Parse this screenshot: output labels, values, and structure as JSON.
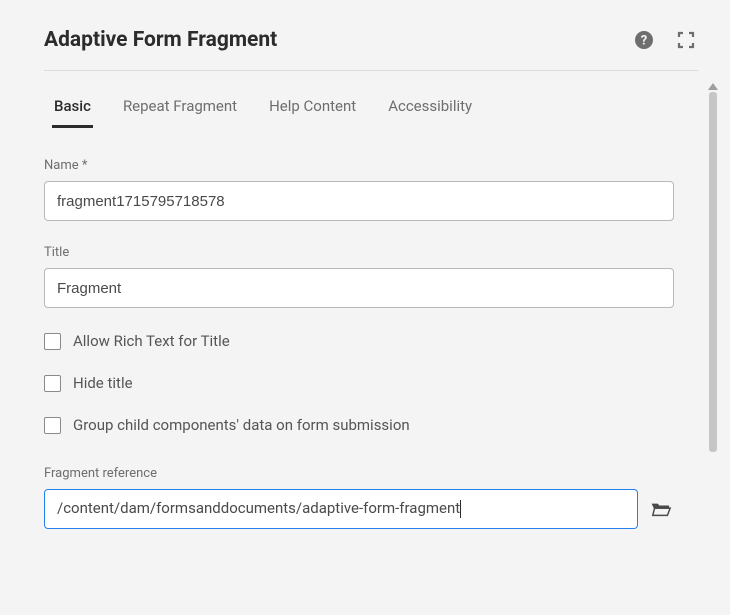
{
  "header": {
    "title": "Adaptive Form Fragment"
  },
  "tabs": {
    "basic": "Basic",
    "repeat": "Repeat Fragment",
    "help": "Help Content",
    "accessibility": "Accessibility"
  },
  "form": {
    "name": {
      "label": "Name *",
      "value": "fragment1715795718578"
    },
    "title": {
      "label": "Title",
      "value": "Fragment"
    },
    "allow_rich_text": {
      "label": "Allow Rich Text for Title"
    },
    "hide_title": {
      "label": "Hide title"
    },
    "group_child": {
      "label": "Group child components' data on form submission"
    },
    "fragment_ref": {
      "label": "Fragment reference",
      "value": "/content/dam/formsanddocuments/adaptive-form-fragment"
    }
  }
}
